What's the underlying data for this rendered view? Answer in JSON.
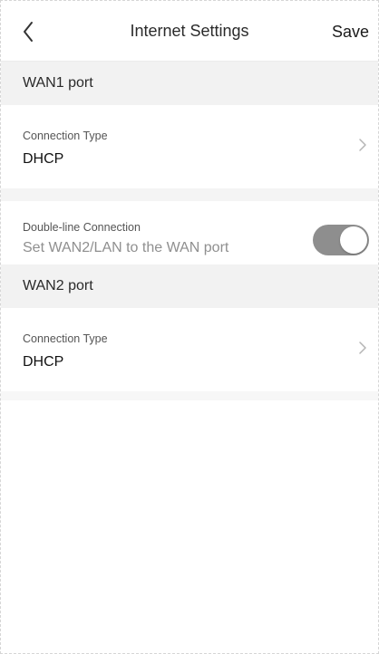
{
  "header": {
    "back_icon": "chevron-left-icon",
    "title": "Internet Settings",
    "save_label": "Save"
  },
  "wan1": {
    "section_title": "WAN1 port",
    "connection_type_label": "Connection Type",
    "connection_type_value": "DHCP"
  },
  "double_line": {
    "label": "Double-line Connection",
    "description": "Set WAN2/LAN to the WAN port",
    "enabled": true
  },
  "wan2": {
    "section_title": "WAN2 port",
    "connection_type_label": "Connection Type",
    "connection_type_value": "DHCP"
  },
  "colors": {
    "toggle_on": "#8e8e8e",
    "section_bg": "#f2f2f2",
    "divider": "#ececec"
  }
}
